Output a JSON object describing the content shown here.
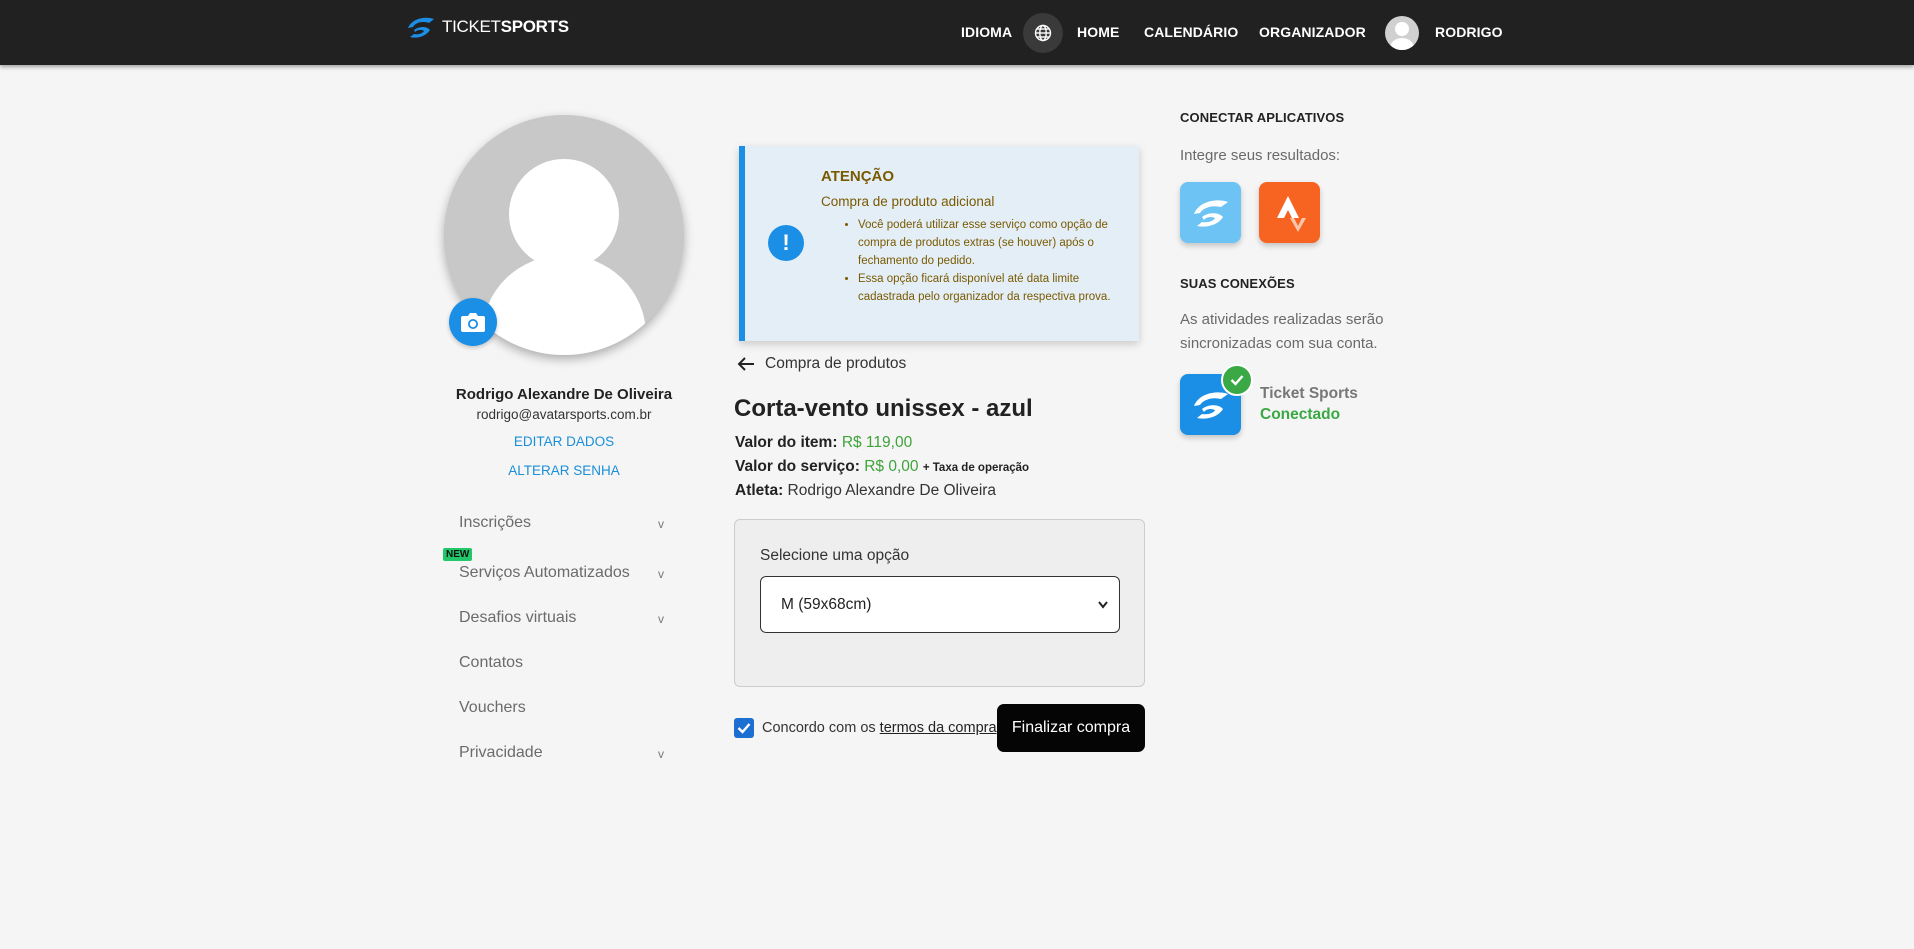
{
  "navbar": {
    "logo_ticket": "TICKET",
    "logo_sports": "SPORTS",
    "idioma": "IDIOMA",
    "home": "HOME",
    "calendario": "CALENDÁRIO",
    "organizador": "ORGANIZADOR",
    "user": "RODRIGO"
  },
  "profile": {
    "name": "Rodrigo Alexandre De Oliveira",
    "email": "rodrigo@avatarsports.com.br",
    "edit_link": "EDITAR DADOS",
    "password_link": "ALTERAR SENHA"
  },
  "sidebar": {
    "new_badge": "NEW",
    "items": [
      {
        "label": "Inscrições",
        "expandable": true
      },
      {
        "label": "Serviços Automatizados",
        "expandable": true
      },
      {
        "label": "Desafios virtuais",
        "expandable": true
      },
      {
        "label": "Contatos",
        "expandable": false
      },
      {
        "label": "Vouchers",
        "expandable": false
      },
      {
        "label": "Privacidade",
        "expandable": true
      }
    ],
    "chevron": "v"
  },
  "alert": {
    "title": "ATENÇÃO",
    "subtitle": "Compra de produto adicional",
    "bullets": [
      "Você poderá utilizar esse serviço como opção de compra de produtos extras (se houver) após o fechamento do pedido.",
      "Essa opção ficará disponível até data limite cadastrada pelo organizador da respectiva prova."
    ],
    "icon_glyph": "!"
  },
  "product": {
    "back_label": "Compra de produtos",
    "title": "Corta-vento unissex - azul",
    "item_label": "Valor do item:",
    "item_value": "R$ 119,00",
    "service_label": "Valor do serviço:",
    "service_value": "R$ 0,00",
    "service_note": "+ Taxa de operação",
    "athlete_label": "Atleta:",
    "athlete_value": "Rodrigo Alexandre De Oliveira",
    "select_label": "Selecione uma opção",
    "select_value": "M (59x68cm)",
    "agree_prefix": "Concordo com os ",
    "agree_link": "termos da compra",
    "agree_checked": true,
    "submit": "Finalizar compra"
  },
  "right": {
    "connect_title": "CONECTAR APLICATIVOS",
    "connect_text": "Integre seus resultados:",
    "apps": [
      "ticket-sports-app-icon",
      "strava-app-icon"
    ],
    "connections_title": "SUAS CONEXÕES",
    "connections_text": "As atividades realizadas serão sincronizadas com sua conta.",
    "connection_name": "Ticket Sports",
    "connection_status": "Conectado"
  },
  "colors": {
    "nav_bg": "#212121",
    "accent_blue": "#1b8ee6",
    "price_green": "#3fa33a",
    "connected_green": "#3aa844",
    "strava_orange": "#f76321"
  }
}
